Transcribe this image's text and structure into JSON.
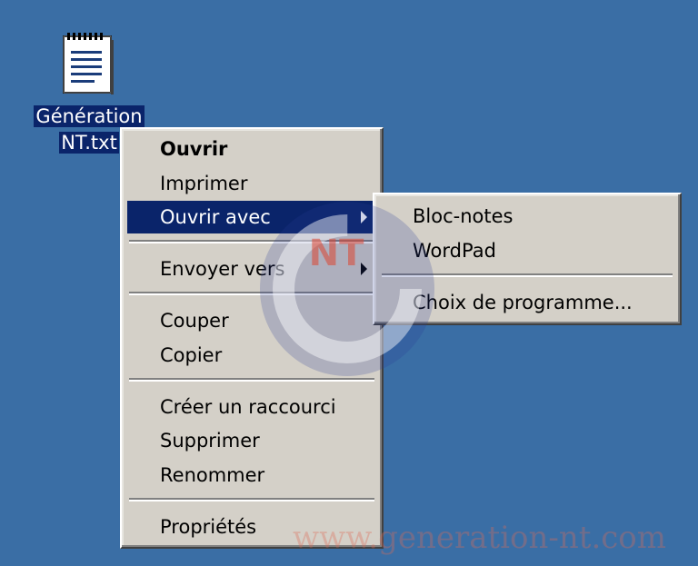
{
  "desktop": {
    "background_color": "#3a6ea5",
    "icon": {
      "name": "notepad-text-file-icon",
      "label_line1": "Génération",
      "label_line2": "NT.txt"
    }
  },
  "context_menu": {
    "items": [
      {
        "label": "Ouvrir",
        "bold": true
      },
      {
        "label": "Imprimer"
      },
      {
        "label": "Ouvrir avec",
        "highlighted": true,
        "has_submenu": true
      },
      {
        "label": "Envoyer vers",
        "has_submenu": true
      },
      {
        "label": "Couper"
      },
      {
        "label": "Copier"
      },
      {
        "label": "Créer un raccourci"
      },
      {
        "label": "Supprimer"
      },
      {
        "label": "Renommer"
      },
      {
        "label": "Propriétés"
      }
    ]
  },
  "submenu": {
    "items": [
      {
        "label": "Bloc-notes"
      },
      {
        "label": "WordPad"
      },
      {
        "label": "Choix de programme..."
      }
    ]
  },
  "watermark": {
    "logo_text": "NT",
    "url": "www.generation-nt.com"
  },
  "colors": {
    "highlight": "#0a246a",
    "menu_face": "#d4d0c8"
  }
}
